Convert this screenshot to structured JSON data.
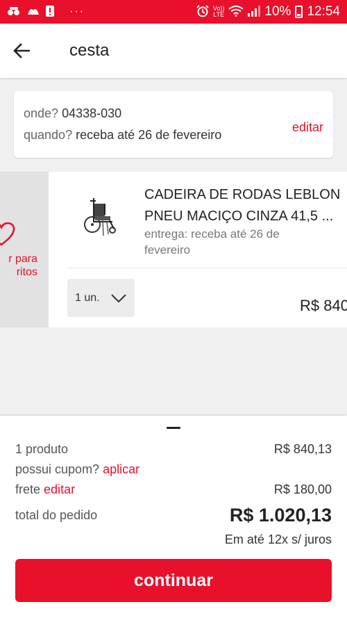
{
  "status_bar": {
    "time": "12:54",
    "battery_percent": "10%",
    "network_label_top": "Vo))",
    "network_label_bottom": "LTE",
    "icons": [
      "notification-icon",
      "notification-icon",
      "alert-icon",
      "more-dots-icon",
      "alarm-icon",
      "volte-icon",
      "wifi-icon",
      "signal-icon",
      "battery-icon"
    ]
  },
  "header": {
    "title": "cesta"
  },
  "delivery": {
    "where_label": "onde?",
    "where_value": "04338-030",
    "when_label": "quando?",
    "when_value": "receba até 26 de fevereiro",
    "edit_label": "editar"
  },
  "item": {
    "fav_label_line1": "r para",
    "fav_label_line2": "ritos",
    "title_line1": "CADEIRA DE RODAS LEBLON",
    "title_line2": "PNEU MACIÇO CINZA 41,5 ...",
    "delivery_line1": "entrega: receba até 26 de",
    "delivery_line2": "fevereiro",
    "quantity": "1 un.",
    "price": "R$ 840"
  },
  "summary": {
    "products_label": "1 produto",
    "products_value": "R$ 840,13",
    "coupon_label": "possui cupom?",
    "coupon_link": "aplicar",
    "shipping_label": "frete",
    "shipping_link": "editar",
    "shipping_value": "R$ 180,00",
    "total_label": "total do pedido",
    "total_value": "R$ 1.020,13",
    "installments": "Em até 12x s/ juros",
    "continue_label": "continuar"
  },
  "colors": {
    "accent": "#e8102a",
    "background": "#f0f0f0"
  }
}
